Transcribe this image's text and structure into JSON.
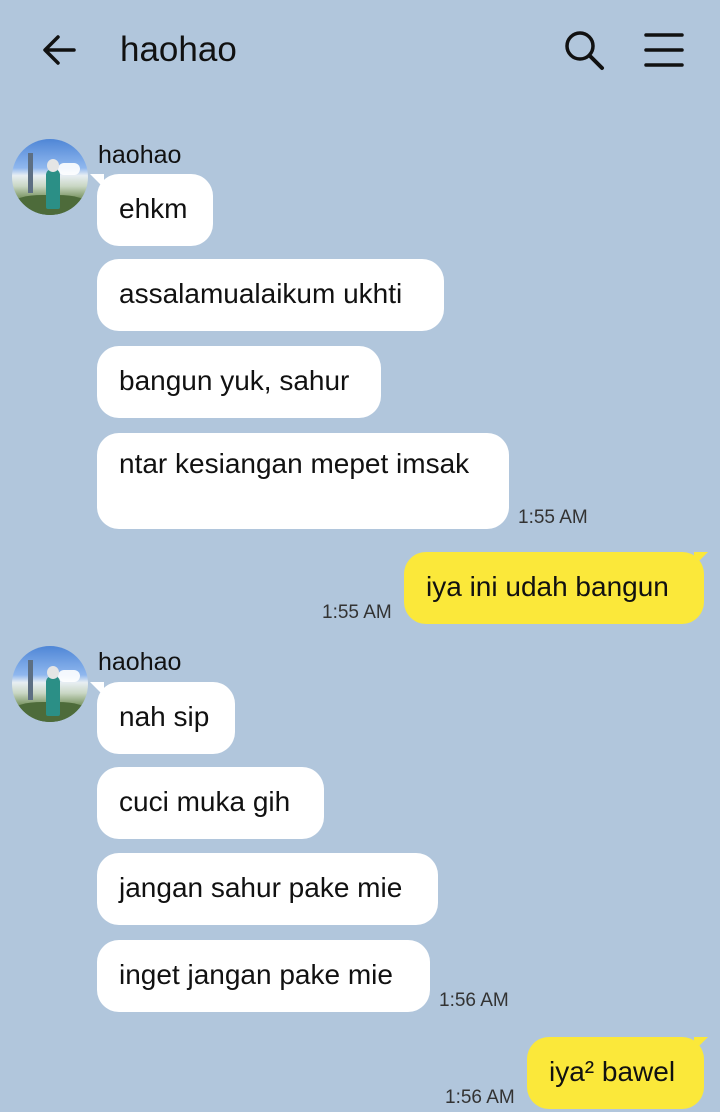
{
  "header": {
    "title": "haohao",
    "back_icon": "arrow-left-icon",
    "search_icon": "search-icon",
    "menu_icon": "hamburger-menu-icon"
  },
  "colors": {
    "background": "#b1c6dc",
    "incoming_bubble": "#ffffff",
    "outgoing_bubble": "#fbe83a"
  },
  "messages": {
    "group1": {
      "sender": "haohao",
      "m1": "ehkm",
      "m2": "assalamualaikum ukhti",
      "m3": "bangun yuk, sahur",
      "m4": "ntar kesiangan mepet imsak",
      "time": "1:55 AM"
    },
    "out1": {
      "text": "iya ini udah bangun",
      "time": "1:55 AM"
    },
    "group2": {
      "sender": "haohao",
      "m1": "nah sip",
      "m2": "cuci muka gih",
      "m3": "jangan sahur pake mie",
      "m4": "inget jangan pake mie",
      "time": "1:56 AM"
    },
    "out2": {
      "text": "iya² bawel",
      "time": "1:56 AM"
    }
  }
}
